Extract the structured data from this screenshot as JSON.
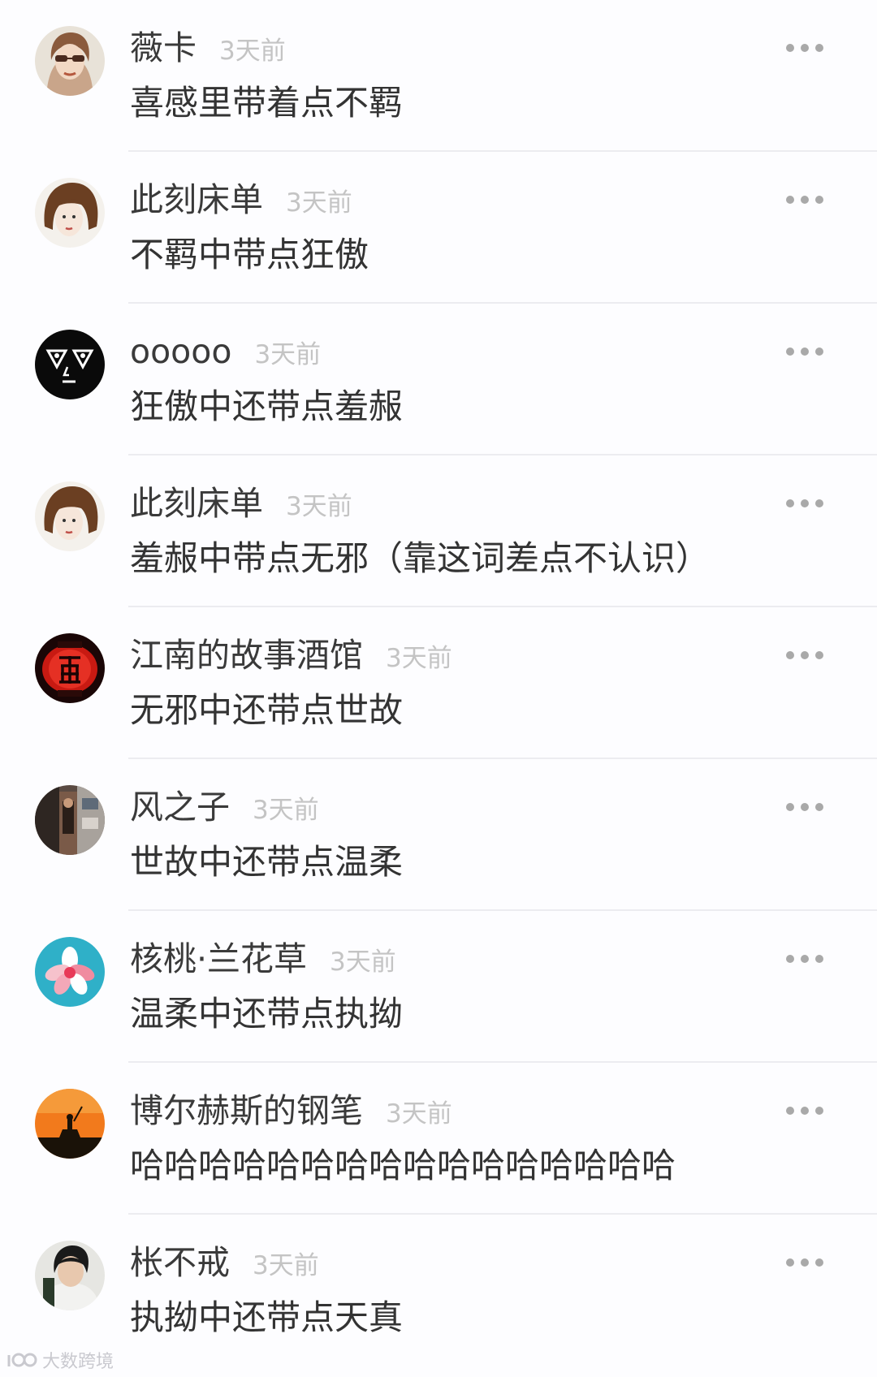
{
  "comments": [
    {
      "username": "薇卡",
      "time": "3天前",
      "text": "喜感里带着点不羁",
      "avatar": "avatar-woman-with-sunglasses"
    },
    {
      "username": "此刻床单",
      "time": "3天前",
      "text": "不羁中带点狂傲",
      "avatar": "avatar-bob-hair-girl"
    },
    {
      "username": "ooooo",
      "time": "3天前",
      "text": "狂傲中还带点羞赧",
      "avatar": "avatar-black-triangle-face"
    },
    {
      "username": "此刻床单",
      "time": "3天前",
      "text": "羞赧中带点无邪（靠这词差点不认识）",
      "avatar": "avatar-bob-hair-girl"
    },
    {
      "username": "江南的故事酒馆",
      "time": "3天前",
      "text": "无邪中还带点世故",
      "avatar": "avatar-red-wine-lantern"
    },
    {
      "username": "风之子",
      "time": "3天前",
      "text": "世故中还带点温柔",
      "avatar": "avatar-street-photo"
    },
    {
      "username": "核桃·兰花草",
      "time": "3天前",
      "text": "温柔中还带点执拗",
      "avatar": "avatar-pink-flower-on-blue"
    },
    {
      "username": "博尔赫斯的钢笔",
      "time": "3天前",
      "text": "哈哈哈哈哈哈哈哈哈哈哈哈哈哈哈哈",
      "avatar": "avatar-rider-on-orange-sunset"
    },
    {
      "username": "枨不戒",
      "time": "3天前",
      "text": "执拗中还带点天真",
      "avatar": "avatar-man-portrait"
    }
  ],
  "watermark": {
    "text": "大数跨境",
    "icon": "watermark-logo-icon"
  },
  "colors": {
    "background": "#fdfdff",
    "username": "#3a3a3a",
    "text": "#333333",
    "time": "#c4c4c4",
    "more_dots": "#a9a9a9",
    "divider": "#ececf0"
  }
}
